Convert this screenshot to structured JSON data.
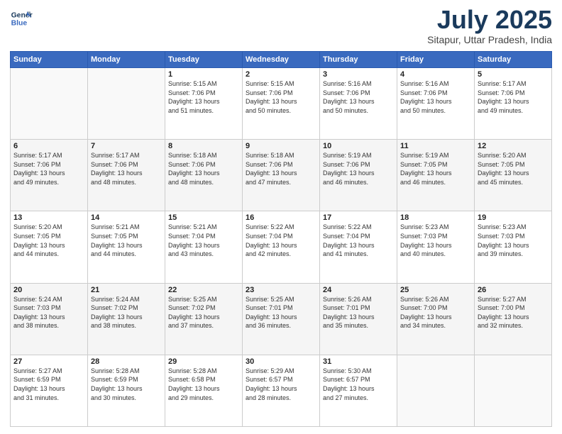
{
  "header": {
    "logo_line1": "General",
    "logo_line2": "Blue",
    "month": "July 2025",
    "location": "Sitapur, Uttar Pradesh, India"
  },
  "weekdays": [
    "Sunday",
    "Monday",
    "Tuesday",
    "Wednesday",
    "Thursday",
    "Friday",
    "Saturday"
  ],
  "weeks": [
    [
      {
        "day": "",
        "info": ""
      },
      {
        "day": "",
        "info": ""
      },
      {
        "day": "1",
        "info": "Sunrise: 5:15 AM\nSunset: 7:06 PM\nDaylight: 13 hours\nand 51 minutes."
      },
      {
        "day": "2",
        "info": "Sunrise: 5:15 AM\nSunset: 7:06 PM\nDaylight: 13 hours\nand 50 minutes."
      },
      {
        "day": "3",
        "info": "Sunrise: 5:16 AM\nSunset: 7:06 PM\nDaylight: 13 hours\nand 50 minutes."
      },
      {
        "day": "4",
        "info": "Sunrise: 5:16 AM\nSunset: 7:06 PM\nDaylight: 13 hours\nand 50 minutes."
      },
      {
        "day": "5",
        "info": "Sunrise: 5:17 AM\nSunset: 7:06 PM\nDaylight: 13 hours\nand 49 minutes."
      }
    ],
    [
      {
        "day": "6",
        "info": "Sunrise: 5:17 AM\nSunset: 7:06 PM\nDaylight: 13 hours\nand 49 minutes."
      },
      {
        "day": "7",
        "info": "Sunrise: 5:17 AM\nSunset: 7:06 PM\nDaylight: 13 hours\nand 48 minutes."
      },
      {
        "day": "8",
        "info": "Sunrise: 5:18 AM\nSunset: 7:06 PM\nDaylight: 13 hours\nand 48 minutes."
      },
      {
        "day": "9",
        "info": "Sunrise: 5:18 AM\nSunset: 7:06 PM\nDaylight: 13 hours\nand 47 minutes."
      },
      {
        "day": "10",
        "info": "Sunrise: 5:19 AM\nSunset: 7:06 PM\nDaylight: 13 hours\nand 46 minutes."
      },
      {
        "day": "11",
        "info": "Sunrise: 5:19 AM\nSunset: 7:05 PM\nDaylight: 13 hours\nand 46 minutes."
      },
      {
        "day": "12",
        "info": "Sunrise: 5:20 AM\nSunset: 7:05 PM\nDaylight: 13 hours\nand 45 minutes."
      }
    ],
    [
      {
        "day": "13",
        "info": "Sunrise: 5:20 AM\nSunset: 7:05 PM\nDaylight: 13 hours\nand 44 minutes."
      },
      {
        "day": "14",
        "info": "Sunrise: 5:21 AM\nSunset: 7:05 PM\nDaylight: 13 hours\nand 44 minutes."
      },
      {
        "day": "15",
        "info": "Sunrise: 5:21 AM\nSunset: 7:04 PM\nDaylight: 13 hours\nand 43 minutes."
      },
      {
        "day": "16",
        "info": "Sunrise: 5:22 AM\nSunset: 7:04 PM\nDaylight: 13 hours\nand 42 minutes."
      },
      {
        "day": "17",
        "info": "Sunrise: 5:22 AM\nSunset: 7:04 PM\nDaylight: 13 hours\nand 41 minutes."
      },
      {
        "day": "18",
        "info": "Sunrise: 5:23 AM\nSunset: 7:03 PM\nDaylight: 13 hours\nand 40 minutes."
      },
      {
        "day": "19",
        "info": "Sunrise: 5:23 AM\nSunset: 7:03 PM\nDaylight: 13 hours\nand 39 minutes."
      }
    ],
    [
      {
        "day": "20",
        "info": "Sunrise: 5:24 AM\nSunset: 7:03 PM\nDaylight: 13 hours\nand 38 minutes."
      },
      {
        "day": "21",
        "info": "Sunrise: 5:24 AM\nSunset: 7:02 PM\nDaylight: 13 hours\nand 38 minutes."
      },
      {
        "day": "22",
        "info": "Sunrise: 5:25 AM\nSunset: 7:02 PM\nDaylight: 13 hours\nand 37 minutes."
      },
      {
        "day": "23",
        "info": "Sunrise: 5:25 AM\nSunset: 7:01 PM\nDaylight: 13 hours\nand 36 minutes."
      },
      {
        "day": "24",
        "info": "Sunrise: 5:26 AM\nSunset: 7:01 PM\nDaylight: 13 hours\nand 35 minutes."
      },
      {
        "day": "25",
        "info": "Sunrise: 5:26 AM\nSunset: 7:00 PM\nDaylight: 13 hours\nand 34 minutes."
      },
      {
        "day": "26",
        "info": "Sunrise: 5:27 AM\nSunset: 7:00 PM\nDaylight: 13 hours\nand 32 minutes."
      }
    ],
    [
      {
        "day": "27",
        "info": "Sunrise: 5:27 AM\nSunset: 6:59 PM\nDaylight: 13 hours\nand 31 minutes."
      },
      {
        "day": "28",
        "info": "Sunrise: 5:28 AM\nSunset: 6:59 PM\nDaylight: 13 hours\nand 30 minutes."
      },
      {
        "day": "29",
        "info": "Sunrise: 5:28 AM\nSunset: 6:58 PM\nDaylight: 13 hours\nand 29 minutes."
      },
      {
        "day": "30",
        "info": "Sunrise: 5:29 AM\nSunset: 6:57 PM\nDaylight: 13 hours\nand 28 minutes."
      },
      {
        "day": "31",
        "info": "Sunrise: 5:30 AM\nSunset: 6:57 PM\nDaylight: 13 hours\nand 27 minutes."
      },
      {
        "day": "",
        "info": ""
      },
      {
        "day": "",
        "info": ""
      }
    ]
  ]
}
